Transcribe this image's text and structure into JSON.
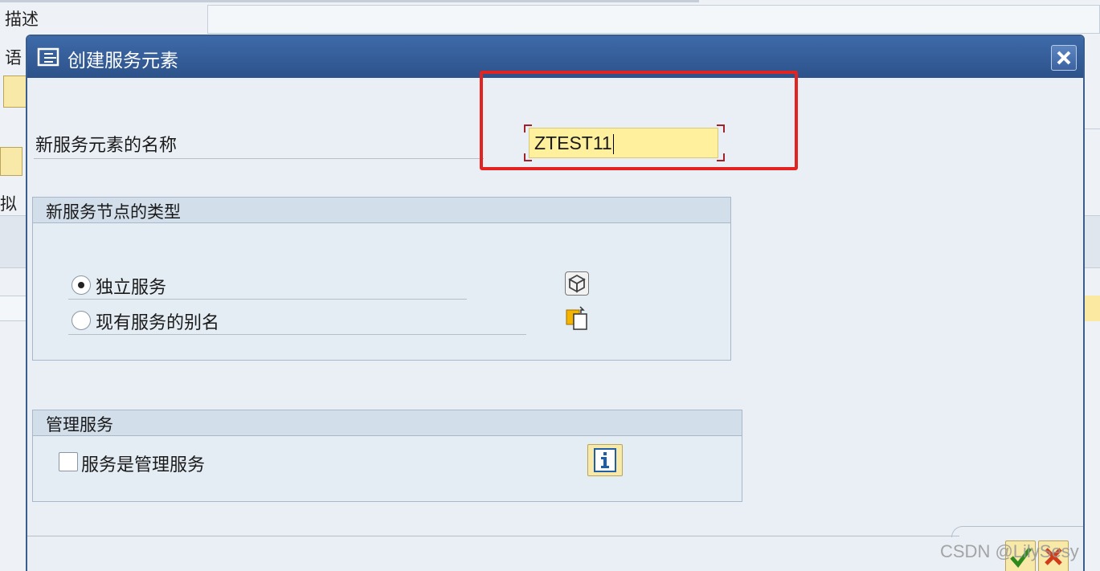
{
  "background": {
    "description_label": "描述",
    "language_label": "语",
    "virtual_label": "拟"
  },
  "dialog": {
    "title": "创建服务元素",
    "name_label": "新服务元素的名称",
    "name_value": "ZTEST11",
    "node_type_group": {
      "title": "新服务节点的类型",
      "options": [
        {
          "label": "独立服务",
          "selected": true,
          "icon": "cube-icon"
        },
        {
          "label": "现有服务的别名",
          "selected": false,
          "icon": "alias-copy-icon"
        }
      ]
    },
    "admin_group": {
      "title": "管理服务",
      "checkbox_label": "服务是管理服务",
      "checked": false
    }
  },
  "watermark": "CSDN @LilySesy",
  "colors": {
    "titlebar": "#2d528a",
    "input_bg": "#fff09e",
    "highlight": "#e3231f"
  }
}
